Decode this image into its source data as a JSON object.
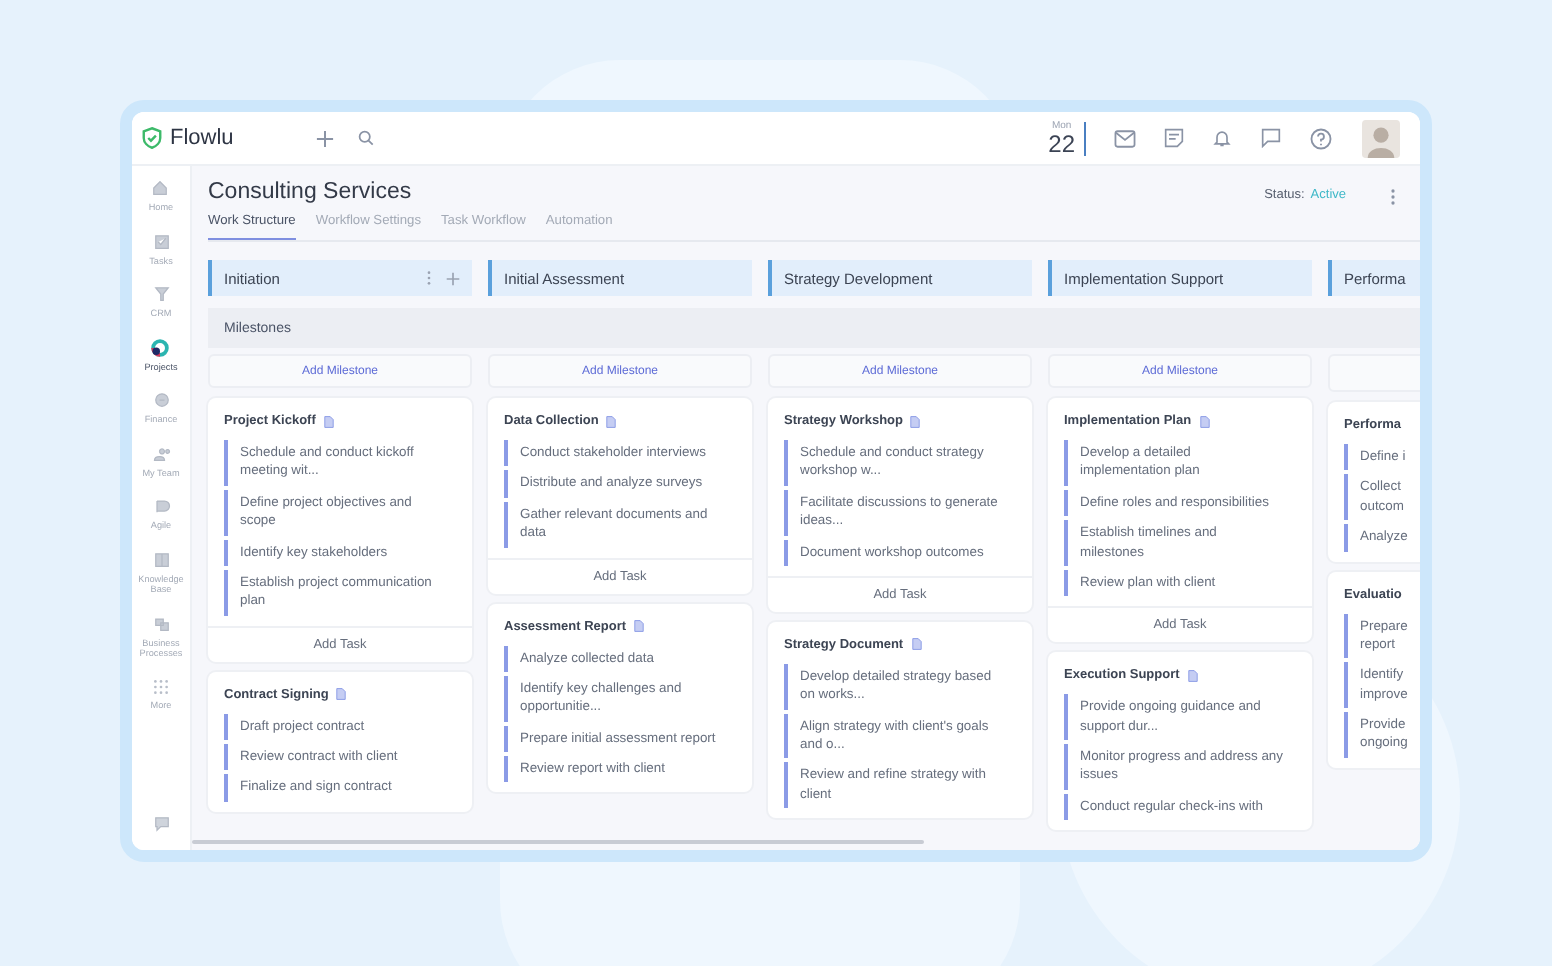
{
  "topbar": {
    "logo": "Flowlu",
    "date": {
      "weekday": "Mon",
      "day": "22"
    }
  },
  "sidebar": {
    "items": [
      {
        "label": "Home",
        "selected": false
      },
      {
        "label": "Tasks",
        "selected": false
      },
      {
        "label": "CRM",
        "selected": false
      },
      {
        "label": "Projects",
        "selected": true
      },
      {
        "label": "Finance",
        "selected": false
      },
      {
        "label": "My Team",
        "selected": false
      },
      {
        "label": "Agile",
        "selected": false
      },
      {
        "label": "Knowledge Base",
        "selected": false
      },
      {
        "label": "Business Processes",
        "selected": false
      },
      {
        "label": "More",
        "selected": false
      }
    ]
  },
  "project": {
    "title": "Consulting Services",
    "status_label": "Status:",
    "status": "Active"
  },
  "tabs": [
    {
      "label": "Work Structure",
      "selected": true
    },
    {
      "label": "Workflow Settings",
      "selected": false
    },
    {
      "label": "Task Workflow",
      "selected": false
    },
    {
      "label": "Automation",
      "selected": false
    }
  ],
  "milestones_label": "Milestones",
  "columns": [
    {
      "title": "Initiation",
      "show_actions": true,
      "add_milestone": "Add Milestone",
      "cards": [
        {
          "title": "Project Kickoff",
          "tasks": [
            "Schedule and conduct kickoff meeting wit...",
            "Define project objectives and scope",
            "Identify key stakeholders",
            "Establish project communication plan"
          ],
          "add_task": "Add Task"
        },
        {
          "title": "Contract Signing",
          "tasks": [
            "Draft project contract",
            "Review contract with client",
            "Finalize and sign contract"
          ]
        }
      ]
    },
    {
      "title": "Initial Assessment",
      "show_actions": false,
      "add_milestone": "Add Milestone",
      "cards": [
        {
          "title": "Data Collection",
          "tasks": [
            "Conduct stakeholder interviews",
            "Distribute and analyze surveys",
            "Gather relevant documents and data"
          ],
          "add_task": "Add Task"
        },
        {
          "title": "Assessment Report",
          "tasks": [
            "Analyze collected data",
            "Identify key challenges and opportunitie...",
            "Prepare initial assessment report",
            "Review report with client"
          ]
        }
      ]
    },
    {
      "title": "Strategy Development",
      "show_actions": false,
      "add_milestone": "Add Milestone",
      "cards": [
        {
          "title": "Strategy Workshop",
          "tasks": [
            "Schedule and conduct strategy workshop w...",
            "Facilitate discussions to generate ideas...",
            "Document workshop outcomes"
          ],
          "add_task": "Add Task"
        },
        {
          "title": "Strategy Document",
          "tasks": [
            "Develop detailed strategy based on works...",
            "Align strategy with client's goals and o...",
            "Review and refine strategy with client"
          ]
        }
      ]
    },
    {
      "title": "Implementation Support",
      "show_actions": false,
      "add_milestone": "Add Milestone",
      "cards": [
        {
          "title": "Implementation Plan",
          "tasks": [
            "Develop a detailed implementation plan",
            "Define roles and responsibilities",
            "Establish timelines and milestones",
            "Review plan with client"
          ],
          "add_task": "Add Task"
        },
        {
          "title": "Execution Support",
          "tasks": [
            "Provide ongoing guidance and support dur...",
            "Monitor progress and address any issues",
            "Conduct regular check-ins with"
          ]
        }
      ]
    },
    {
      "title": "Performa",
      "cards": [
        {
          "title": "Performa",
          "tasks": [
            "Define i",
            "Collect outcom",
            "Analyze"
          ]
        },
        {
          "title": "Evaluatio",
          "tasks": [
            "Prepare report",
            "Identify improve",
            "Provide ongoing"
          ]
        }
      ]
    }
  ]
}
